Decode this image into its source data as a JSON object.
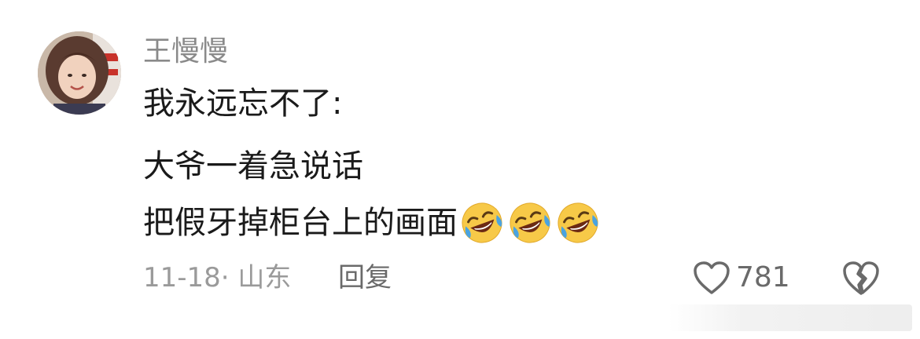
{
  "comment": {
    "username": "王慢慢",
    "lines": [
      "我永远忘不了:",
      "大爷一着急说话",
      "把假牙掉柜台上的画面"
    ],
    "emojis": [
      "rolling-on-floor-laughing",
      "rolling-on-floor-laughing",
      "rolling-on-floor-laughing"
    ],
    "meta": "11-18· 山东",
    "reply_label": "回复",
    "like_count": "781"
  },
  "colors": {
    "username": "#8a8a8a",
    "body_text": "#1a1a1a",
    "meta_text": "#9a9a9a",
    "action_text": "#6a6a6a",
    "emoji_face": "#f7c948",
    "emoji_tear": "#4aa3e0"
  },
  "icons": {
    "like": "heart-outline-icon",
    "dislike": "broken-heart-icon"
  }
}
